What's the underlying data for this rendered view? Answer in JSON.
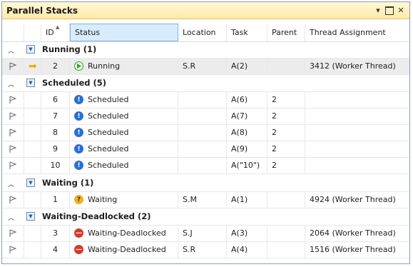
{
  "window": {
    "title": "Parallel Stacks"
  },
  "columns": [
    "ID",
    "Status",
    "Location",
    "Task",
    "Parent",
    "Thread Assignment"
  ],
  "groups": [
    {
      "label": "Running (1)",
      "rows": [
        {
          "id": "2",
          "status": "Running",
          "location": "S.R",
          "task": "A(2)",
          "parent": "",
          "thread": "3412 (Worker Thread)"
        }
      ]
    },
    {
      "label": "Scheduled (5)",
      "rows": [
        {
          "id": "6",
          "status": "Scheduled",
          "location": "",
          "task": "A(6)",
          "parent": "2",
          "thread": ""
        },
        {
          "id": "7",
          "status": "Scheduled",
          "location": "",
          "task": "A(7)",
          "parent": "2",
          "thread": ""
        },
        {
          "id": "8",
          "status": "Scheduled",
          "location": "",
          "task": "A(8)",
          "parent": "2",
          "thread": ""
        },
        {
          "id": "9",
          "status": "Scheduled",
          "location": "",
          "task": "A(9)",
          "parent": "2",
          "thread": ""
        },
        {
          "id": "10",
          "status": "Scheduled",
          "location": "",
          "task": "A(\"10\")",
          "parent": "2",
          "thread": ""
        }
      ]
    },
    {
      "label": "Waiting (1)",
      "rows": [
        {
          "id": "1",
          "status": "Waiting",
          "location": "S.M",
          "task": "A(1)",
          "parent": "",
          "thread": "4924 (Worker Thread)"
        }
      ]
    },
    {
      "label": "Waiting-Deadlocked (2)",
      "rows": [
        {
          "id": "3",
          "status": "Waiting-Deadlocked",
          "location": "S.J",
          "task": "A(3)",
          "parent": "",
          "thread": "2064 (Worker Thread)"
        },
        {
          "id": "4",
          "status": "Waiting-Deadlocked",
          "location": "S.R",
          "task": "A(4)",
          "parent": "",
          "thread": "1516 (Worker Thread)"
        }
      ]
    }
  ]
}
